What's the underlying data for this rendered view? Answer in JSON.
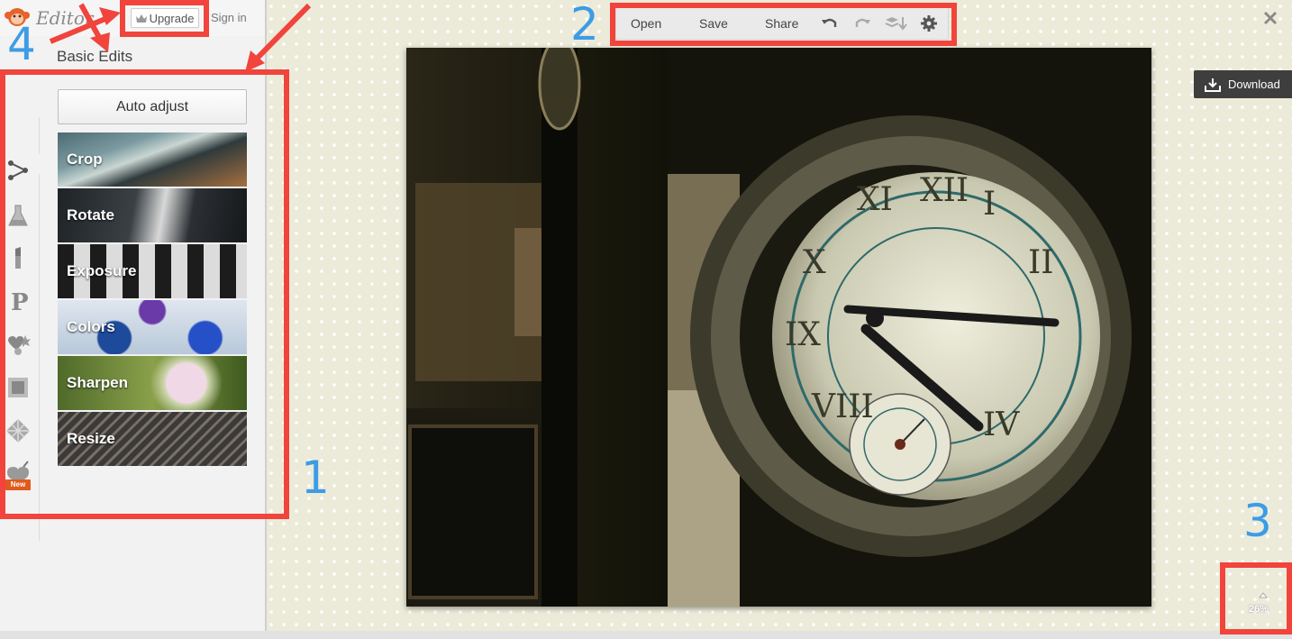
{
  "header": {
    "logo_text": "Editor",
    "upgrade_label": "Upgrade",
    "signin_label": "Sign in"
  },
  "panel": {
    "title": "Basic Edits",
    "auto_adjust_label": "Auto adjust",
    "new_badge": "New",
    "edits": [
      {
        "label": "Crop"
      },
      {
        "label": "Rotate"
      },
      {
        "label": "Exposure"
      },
      {
        "label": "Colors"
      },
      {
        "label": "Sharpen"
      },
      {
        "label": "Resize"
      }
    ],
    "rail_icons": [
      "basic-edits-icon",
      "effects-flask-icon",
      "touch-up-lipstick-icon",
      "text-icon",
      "overlays-icon",
      "frames-icon",
      "textures-icon",
      "seasonal-icon"
    ]
  },
  "toolbar": {
    "open_label": "Open",
    "save_label": "Save",
    "share_label": "Share"
  },
  "download_label": "Download",
  "zoom_level": "26%",
  "annotations": {
    "n1": "1",
    "n2": "2",
    "n3": "3",
    "n4": "4"
  },
  "colors": {
    "annotation_red": "#f0443c",
    "annotation_blue": "#3d9ce6",
    "canvas_bg": "#ecebd9"
  }
}
